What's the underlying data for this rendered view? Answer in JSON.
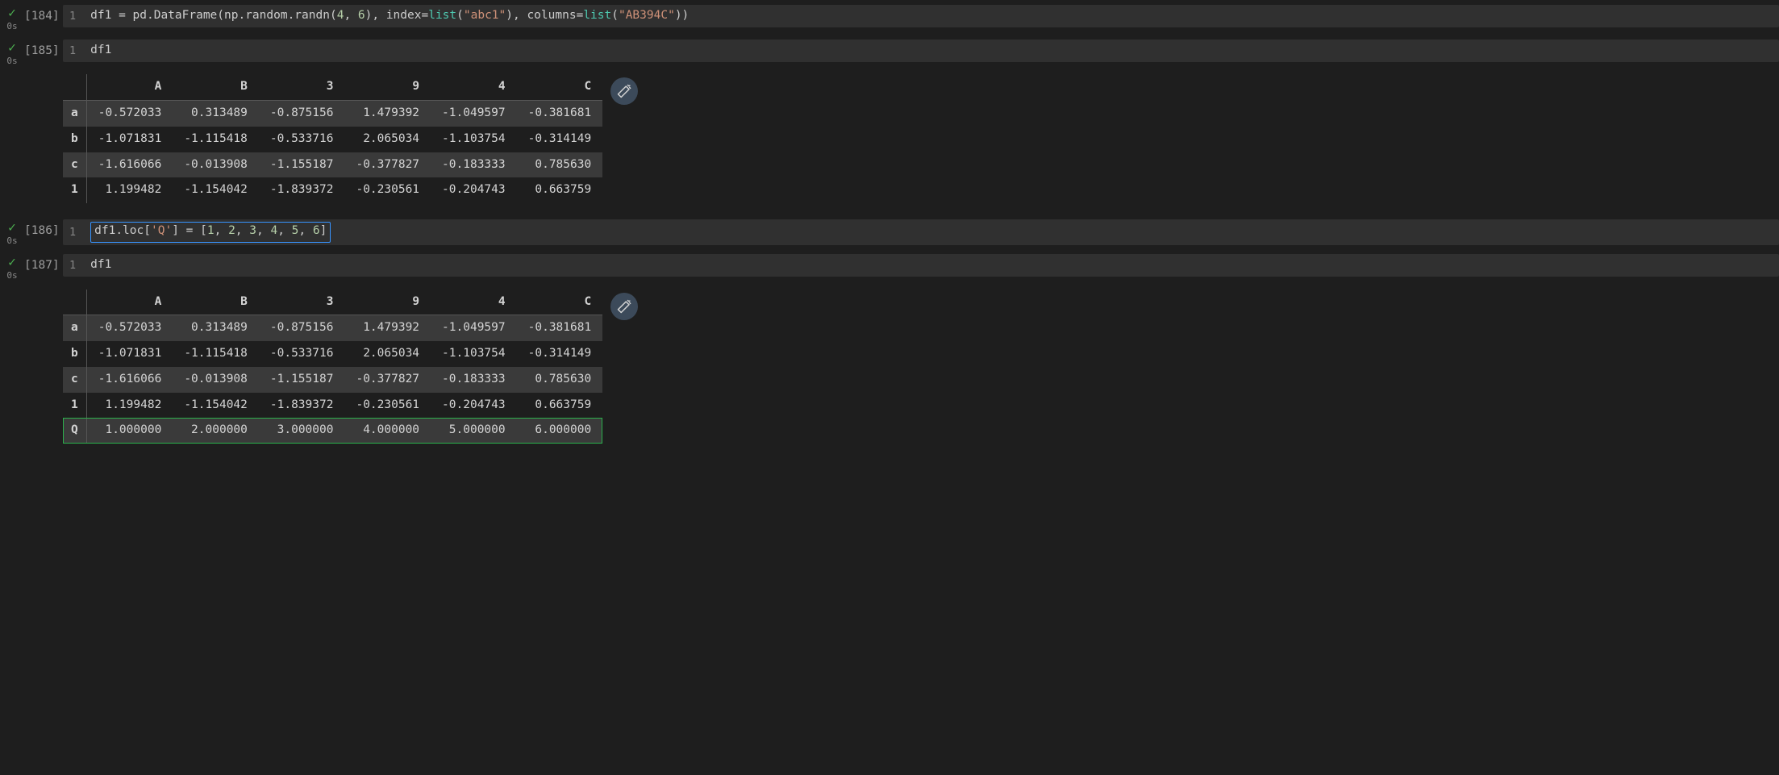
{
  "cells": {
    "c184": {
      "exec": "[184]",
      "timing": "0s",
      "line_no": "1"
    },
    "c185": {
      "exec": "[185]",
      "timing": "0s",
      "line_no": "1",
      "code": "df1"
    },
    "c186": {
      "exec": "[186]",
      "timing": "0s",
      "line_no": "1"
    },
    "c187": {
      "exec": "[187]",
      "timing": "0s",
      "line_no": "1",
      "code": "df1"
    }
  },
  "code184": {
    "t0": "df1 ",
    "t1": "=",
    "t2": " pd.DataFrame(np.random.randn(",
    "num0": "4",
    "t3": ", ",
    "num1": "6",
    "t4": "), index",
    "t5": "=",
    "call0": "list",
    "t6": "(",
    "str0": "\"abc1\"",
    "t7": "), columns",
    "t8": "=",
    "call1": "list",
    "t9": "(",
    "str1": "\"AB394C\"",
    "t10": "))"
  },
  "code186": {
    "t0": "df1.loc[",
    "str0": "'Q'",
    "t1": "] ",
    "t2": "=",
    "t3": " [",
    "n0": "1",
    "c0": ", ",
    "n1": "2",
    "c1": ", ",
    "n2": "3",
    "c2": ", ",
    "n3": "4",
    "c3": ", ",
    "n4": "5",
    "c4": ", ",
    "n5": "6",
    "t4": "]"
  },
  "df1": {
    "columns": [
      "A",
      "B",
      "3",
      "9",
      "4",
      "C"
    ],
    "rows": [
      {
        "idx": "a",
        "vals": [
          "-0.572033",
          "0.313489",
          "-0.875156",
          "1.479392",
          "-1.049597",
          "-0.381681"
        ]
      },
      {
        "idx": "b",
        "vals": [
          "-1.071831",
          "-1.115418",
          "-0.533716",
          "2.065034",
          "-1.103754",
          "-0.314149"
        ]
      },
      {
        "idx": "c",
        "vals": [
          "-1.616066",
          "-0.013908",
          "-1.155187",
          "-0.377827",
          "-0.183333",
          "0.785630"
        ]
      },
      {
        "idx": "1",
        "vals": [
          "1.199482",
          "-1.154042",
          "-1.839372",
          "-0.230561",
          "-0.204743",
          "0.663759"
        ]
      }
    ]
  },
  "df2": {
    "columns": [
      "A",
      "B",
      "3",
      "9",
      "4",
      "C"
    ],
    "rows": [
      {
        "idx": "a",
        "vals": [
          "-0.572033",
          "0.313489",
          "-0.875156",
          "1.479392",
          "-1.049597",
          "-0.381681"
        ]
      },
      {
        "idx": "b",
        "vals": [
          "-1.071831",
          "-1.115418",
          "-0.533716",
          "2.065034",
          "-1.103754",
          "-0.314149"
        ]
      },
      {
        "idx": "c",
        "vals": [
          "-1.616066",
          "-0.013908",
          "-1.155187",
          "-0.377827",
          "-0.183333",
          "0.785630"
        ]
      },
      {
        "idx": "1",
        "vals": [
          "1.199482",
          "-1.154042",
          "-1.839372",
          "-0.230561",
          "-0.204743",
          "0.663759"
        ]
      },
      {
        "idx": "Q",
        "vals": [
          "1.000000",
          "2.000000",
          "3.000000",
          "4.000000",
          "5.000000",
          "6.000000"
        ],
        "highlight": true
      }
    ]
  }
}
